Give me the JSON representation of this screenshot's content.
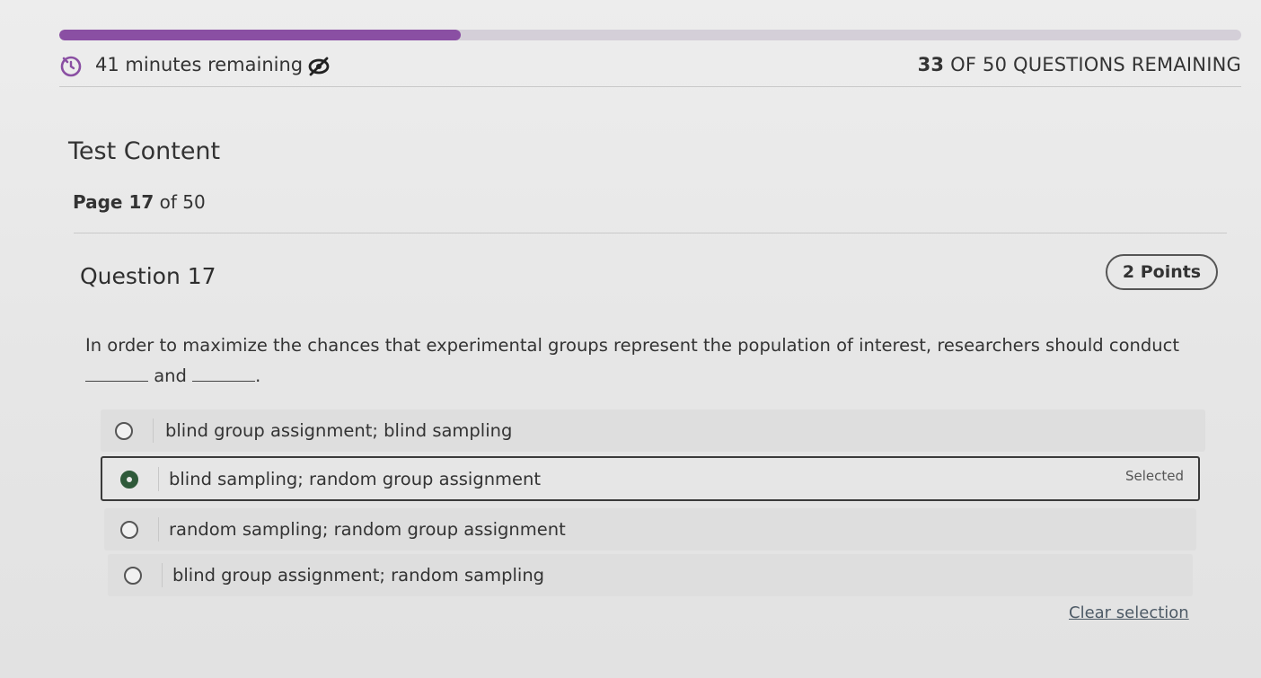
{
  "progress": {
    "fraction": 0.34
  },
  "status": {
    "time_remaining": "41 minutes remaining",
    "questions_remaining_count": "33",
    "questions_remaining_suffix": " OF 50 QUESTIONS REMAINING",
    "timer_icon": "timer-icon",
    "hide_icon": "eye-slash-icon"
  },
  "section": {
    "title": "Test Content",
    "page_label": "Page 17",
    "page_total": " of 50"
  },
  "question": {
    "title": "Question 17",
    "points": "2 Points",
    "text_line1": "In order to maximize the chances that experimental groups represent the population of interest, researchers should conduct",
    "text_mid": " and ",
    "text_end": "."
  },
  "options": [
    {
      "label": "blind group assignment; blind sampling",
      "selected": false
    },
    {
      "label": "blind sampling; random group assignment",
      "selected": true
    },
    {
      "label": "random sampling; random group assignment",
      "selected": false
    },
    {
      "label": "blind group assignment; random sampling",
      "selected": false
    }
  ],
  "selected_tag": "Selected",
  "clear_selection": "Clear selection",
  "colors": {
    "progress_fill": "#8a4fa3",
    "progress_track": "#d4cfd8",
    "selected_radio": "#2f5a3a"
  }
}
